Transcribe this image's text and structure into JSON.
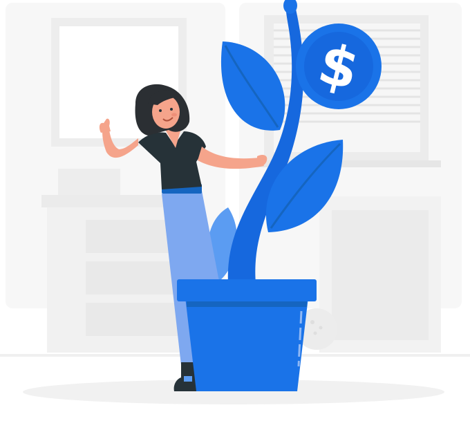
{
  "illustration": {
    "subject": "woman-with-money-plant",
    "coin_symbol": "$"
  },
  "colors": {
    "background": "#ffffff",
    "room_light": "#f5f5f5",
    "room_mid": "#ececec",
    "room_line": "#e3e3e3",
    "brand_blue": "#1a73e8",
    "blue_dark": "#1565c0",
    "blue_light": "#5b9cf2",
    "skin": "#f5a48b",
    "hair": "#2b2f33",
    "shirt": "#263238",
    "jeans": "#7ea8f0",
    "shoe": "#263238",
    "shadow": "#f1f1f1"
  }
}
